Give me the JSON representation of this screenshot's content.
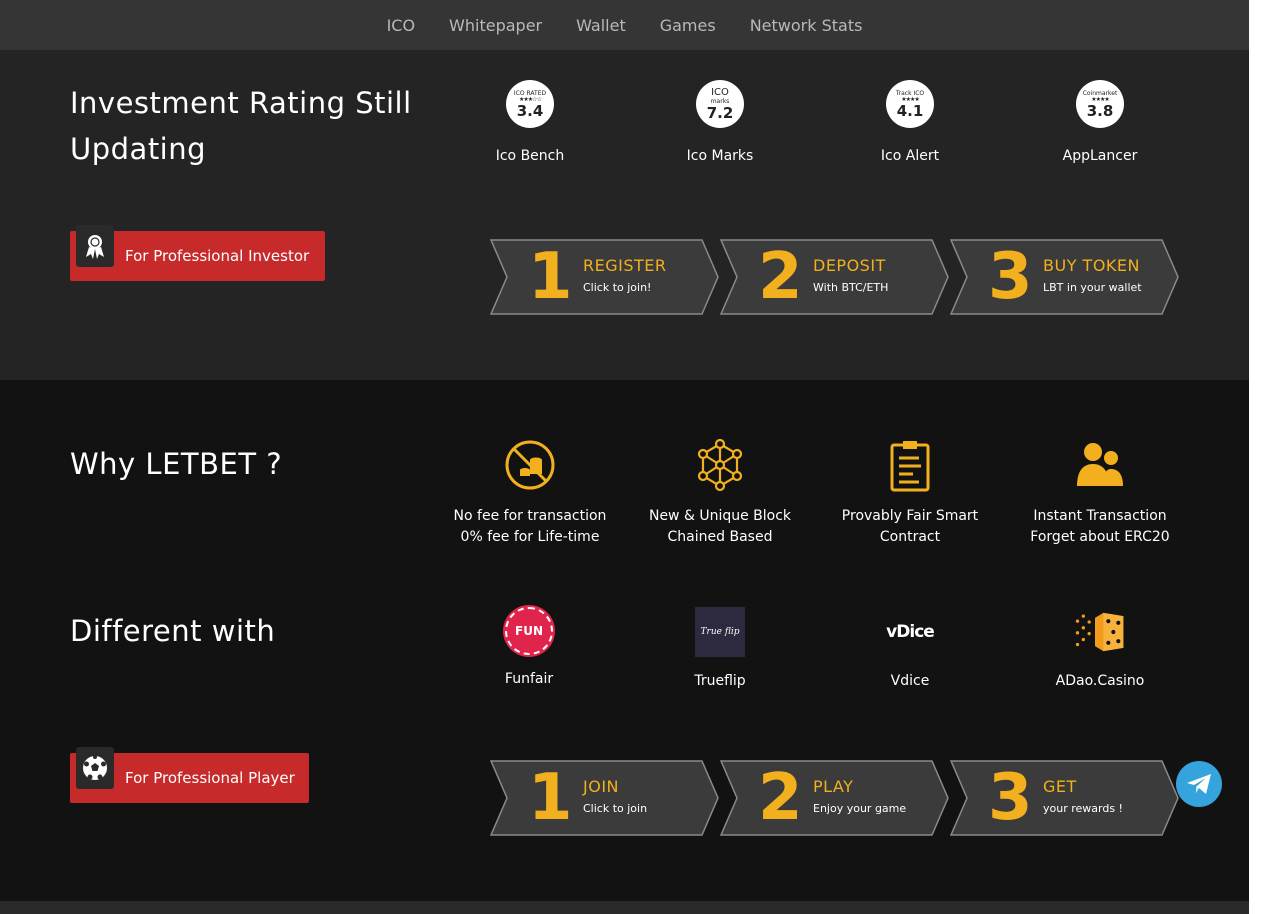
{
  "nav": [
    "ICO",
    "Whitepaper",
    "Wallet",
    "Games",
    "Network Stats"
  ],
  "investment": {
    "heading_line1": "Investment Rating Still",
    "heading_line2": "Updating",
    "ratings": [
      {
        "badge_top": "ICO RATED",
        "badge_score": "3.4",
        "label": "Ico Bench"
      },
      {
        "badge_top": "ICO",
        "badge_sub": "marks",
        "badge_score": "7.2",
        "label": "Ico Marks"
      },
      {
        "badge_top": "Track ICO",
        "badge_score": "4.1",
        "label": "Ico Alert"
      },
      {
        "badge_top": "Coinmarket",
        "badge_score": "3.8",
        "label": "AppLancer"
      }
    ],
    "button_label": "For Professional Investor",
    "steps": [
      {
        "num": "1",
        "title": "REGISTER",
        "sub": "Click to join!"
      },
      {
        "num": "2",
        "title": "DEPOSIT",
        "sub": "With BTC/ETH"
      },
      {
        "num": "3",
        "title": "BUY TOKEN",
        "sub": "LBT in your wallet"
      }
    ]
  },
  "why": {
    "heading": "Why LETBET ?",
    "features": [
      {
        "icon": "no-fee-coins-icon",
        "line1": "No fee for transaction",
        "line2": "0% fee for Life-time"
      },
      {
        "icon": "blockchain-network-icon",
        "line1": "New & Unique Block",
        "line2": "Chained Based"
      },
      {
        "icon": "clipboard-contract-icon",
        "line1": "Provably Fair Smart",
        "line2": "Contract"
      },
      {
        "icon": "users-icon",
        "line1": "Instant Transaction",
        "line2": "Forget about ERC20"
      }
    ]
  },
  "different": {
    "heading": "Different with",
    "competitors": [
      {
        "logo_text": "FUN",
        "label": "Funfair"
      },
      {
        "logo_text": "True flip",
        "label": "Trueflip"
      },
      {
        "logo_text": "vDice",
        "label": "Vdice"
      },
      {
        "logo_text": "",
        "label": "ADao.Casino"
      }
    ],
    "button_label": "For Professional Player",
    "steps": [
      {
        "num": "1",
        "title": "JOIN",
        "sub": "Click to join"
      },
      {
        "num": "2",
        "title": "PLAY",
        "sub": "Enjoy your game"
      },
      {
        "num": "3",
        "title": "GET",
        "sub": "your rewards !"
      }
    ]
  },
  "colors": {
    "accent": "#f2b01e",
    "button_red": "#c62a2a",
    "telegram": "#35a4dd"
  }
}
